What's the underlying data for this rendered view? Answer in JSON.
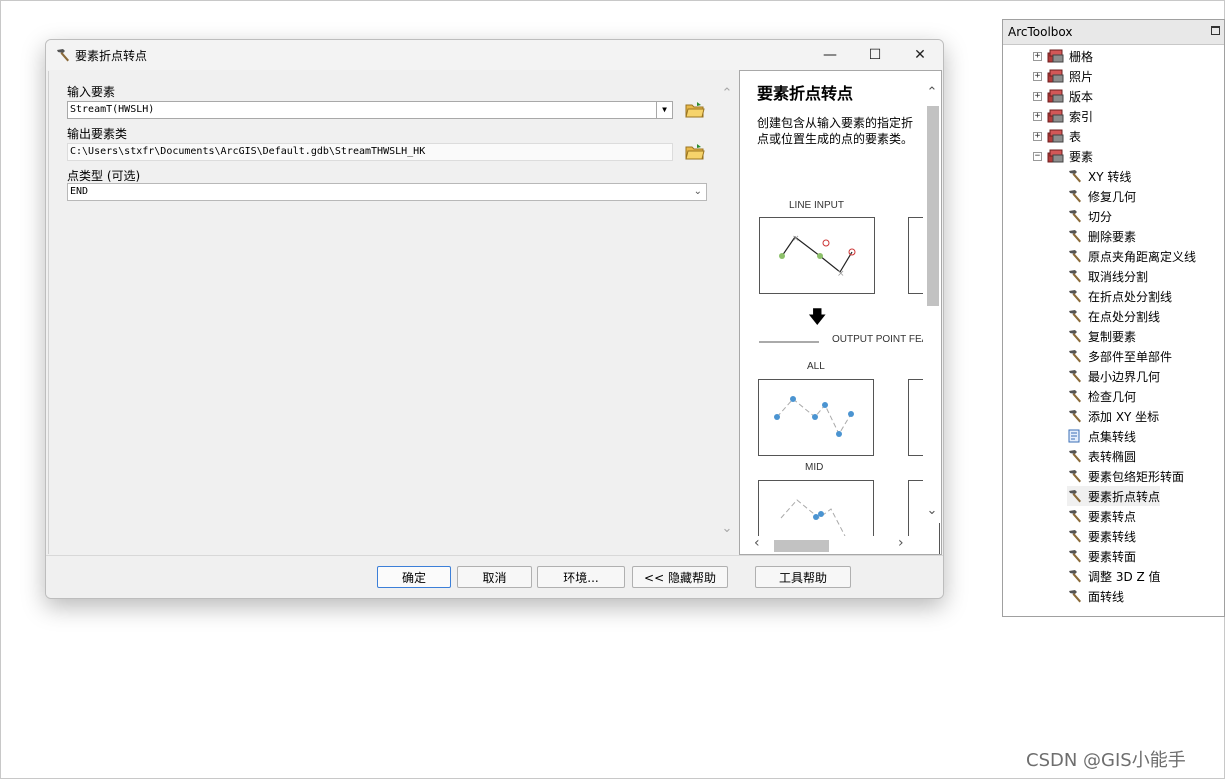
{
  "dialog": {
    "title": "要素折点转点",
    "controls": {
      "minimize": "—",
      "maximize": "☐",
      "close": "✕"
    },
    "params": {
      "input_label": "输入要素",
      "input_value": "StreamT(HWSLH)",
      "output_label": "输出要素类",
      "output_value": "C:\\Users\\stxfr\\Documents\\ArcGIS\\Default.gdb\\StreamTHWSLH_HK",
      "point_type_label": "点类型 (可选)",
      "point_type_value": "END"
    },
    "help": {
      "title": "要素折点转点",
      "description": "创建包含从输入要素的指定折点或位置生成的点的要素类。",
      "diagram_labels": {
        "line_input": "LINE INPUT",
        "output": "OUTPUT POINT FEA",
        "all": "ALL",
        "mid": "MID"
      }
    },
    "buttons": {
      "ok": "确定",
      "cancel": "取消",
      "env": "环境...",
      "hide_help": "<< 隐藏帮助",
      "tool_help": "工具帮助"
    }
  },
  "toolbox": {
    "title": "ArcToolbox",
    "toolsets": [
      {
        "label": "栅格",
        "expanded": false
      },
      {
        "label": "照片",
        "expanded": false
      },
      {
        "label": "版本",
        "expanded": false
      },
      {
        "label": "索引",
        "expanded": false
      },
      {
        "label": "表",
        "expanded": false
      },
      {
        "label": "要素",
        "expanded": true
      }
    ],
    "tools": [
      {
        "label": "XY 转线",
        "icon": "hammer-icon"
      },
      {
        "label": "修复几何",
        "icon": "hammer-icon"
      },
      {
        "label": "切分",
        "icon": "hammer-icon"
      },
      {
        "label": "删除要素",
        "icon": "hammer-icon"
      },
      {
        "label": "原点夹角距离定义线",
        "icon": "hammer-icon"
      },
      {
        "label": "取消线分割",
        "icon": "hammer-icon"
      },
      {
        "label": "在折点处分割线",
        "icon": "hammer-icon"
      },
      {
        "label": "在点处分割线",
        "icon": "hammer-icon"
      },
      {
        "label": "复制要素",
        "icon": "hammer-icon"
      },
      {
        "label": "多部件至单部件",
        "icon": "hammer-icon"
      },
      {
        "label": "最小边界几何",
        "icon": "hammer-icon"
      },
      {
        "label": "检查几何",
        "icon": "hammer-icon"
      },
      {
        "label": "添加 XY 坐标",
        "icon": "hammer-icon"
      },
      {
        "label": "点集转线",
        "icon": "script-icon"
      },
      {
        "label": "表转椭圆",
        "icon": "hammer-icon"
      },
      {
        "label": "要素包络矩形转面",
        "icon": "hammer-icon"
      },
      {
        "label": "要素折点转点",
        "icon": "hammer-icon",
        "selected": true
      },
      {
        "label": "要素转点",
        "icon": "hammer-icon"
      },
      {
        "label": "要素转线",
        "icon": "hammer-icon"
      },
      {
        "label": "要素转面",
        "icon": "hammer-icon"
      },
      {
        "label": "调整 3D Z 值",
        "icon": "hammer-icon"
      },
      {
        "label": "面转线",
        "icon": "hammer-icon"
      }
    ]
  },
  "watermark": "CSDN @GIS小能手"
}
